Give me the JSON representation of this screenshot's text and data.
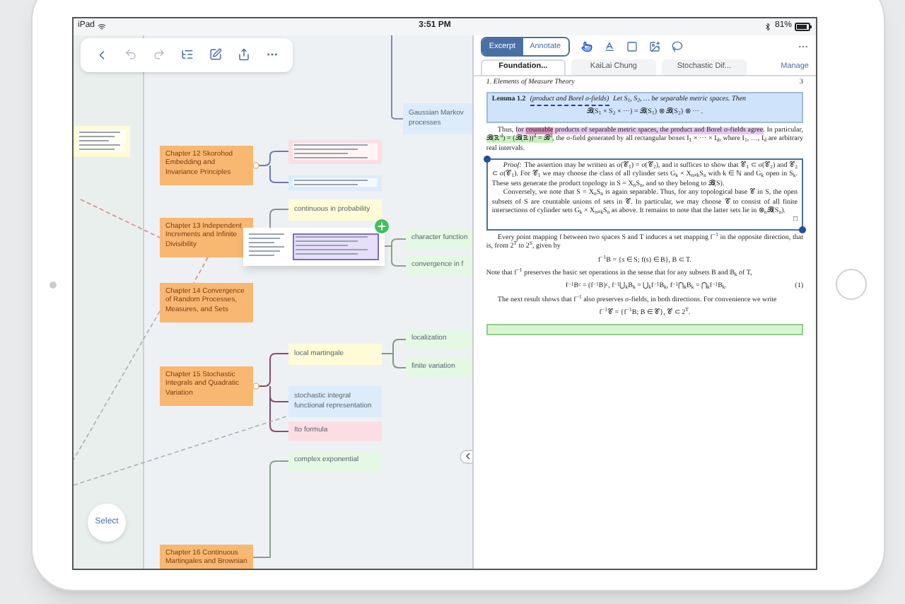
{
  "status_bar": {
    "device": "iPad",
    "time": "3:51 PM",
    "battery": "81%"
  },
  "mindmap": {
    "nodes": [
      {
        "kind": "topic",
        "text": "Gaussian Markov processes",
        "color": "#dcecfb"
      },
      {
        "kind": "snippet",
        "color": "#fffbd6"
      },
      {
        "kind": "chapter",
        "text": "Chapter 12 Skorohod Embedding and Invariance Principles",
        "color": "#f9b872"
      },
      {
        "kind": "snippet",
        "color": "#fddde4"
      },
      {
        "kind": "snippet",
        "color": "#dcecfb"
      },
      {
        "kind": "topic",
        "text": "continuous in probability",
        "color": "#fffbd6"
      },
      {
        "kind": "chapter",
        "text": "Chapter 13 Independent Increments and Infinite Divisibility",
        "color": "#f9b872"
      },
      {
        "kind": "topic",
        "text": "character function",
        "color": "#e4f8e4"
      },
      {
        "kind": "topic",
        "text": "convergence in f",
        "color": "#e4f8e4"
      },
      {
        "kind": "chapter",
        "text": "Chapter 14 Convergence of Random Processes, Measures, and Sets",
        "color": "#f9b872"
      },
      {
        "kind": "topic",
        "text": "local martingale",
        "color": "#fffbd6"
      },
      {
        "kind": "topic",
        "text": "localization",
        "color": "#e4f8e4"
      },
      {
        "kind": "topic",
        "text": "finite variation",
        "color": "#e4f8e4"
      },
      {
        "kind": "chapter",
        "text": "Chapter 15 Stochastic Integrals and Quadratic Variation",
        "color": "#f9b872"
      },
      {
        "kind": "topic",
        "text": "stochastic integral functional representation",
        "color": "#dcecfb"
      },
      {
        "kind": "topic",
        "text": "Ito formula",
        "color": "#fddde4"
      },
      {
        "kind": "topic",
        "text": "complex exponential",
        "color": "#e4f8e4"
      },
      {
        "kind": "chapter",
        "text": "Chapter 16 Continuous Martingales and Brownian",
        "color": "#f9b872"
      },
      {
        "kind": "excerpt",
        "color": "#ffffff"
      }
    ],
    "select_button": "Select"
  },
  "reader": {
    "modes": [
      {
        "label": "Excerpt",
        "selected": true
      },
      {
        "label": "Annotate",
        "selected": false
      }
    ],
    "tools": [
      {
        "kind": "pointer",
        "selected": true
      },
      {
        "kind": "text",
        "selected": false
      },
      {
        "kind": "rectangle",
        "selected": false
      },
      {
        "kind": "image",
        "selected": false
      },
      {
        "kind": "lasso",
        "selected": false
      }
    ],
    "tabs": [
      {
        "label": "Foundation...",
        "selected": true
      },
      {
        "label": "KaiLai Chung",
        "selected": false
      },
      {
        "label": "Stochastic Dif...",
        "selected": false
      }
    ],
    "manage": "Manage",
    "page": {
      "running_head": "1. Elements of Measure Theory",
      "page_number": "3",
      "lemma": {
        "label": "Lemma 1.2",
        "title": "(product and Borel σ-fields)",
        "text": "Let S$_{1}$, S$_{2}$, … be separable metric spaces. Then",
        "formula": "𝓑(S$_{1}$ × S$_{2}$ × ⋯) = 𝓑(S$_{1}$) ⊗ 𝓑(S$_{2}$) ⊗ ⋯ ."
      },
      "paragraph_1": [
        {
          "text": "Thus, "
        },
        {
          "text": "for ",
          "color": "#ecc8f0"
        },
        {
          "text": "countable",
          "color": "#d98fbd"
        },
        {
          "text": " products of separable metric spaces, the product and Borel σ-fields agree",
          "color": "#e6c8f2"
        },
        {
          "text": ". In particular, "
        },
        {
          "text": "𝓑(ℝ$^{d}$) = (𝓑(ℝ))$^{d}$ = 𝓑$^{d}$",
          "color": "#c9f0c0"
        },
        {
          "text": ", the σ-field generated by all rectangular boxes I$_{1}$ × ⋯ × I$_{d}$, where I$_{1}$, …, I$_{d}$ are arbitrary real intervals."
        }
      ],
      "proof": {
        "label": "Proof:",
        "paragraphs": [
          "The assertion may be written as σ(𝒞$_{1}$) = σ(𝒞$_{2}$), and it suffices to show that 𝒞$_{1}$ ⊂ σ(𝒞$_{2}$) and 𝒞$_{2}$ ⊂ σ(𝒞$_{1}$). For 𝒞$_{1}$ we may choose the class of all cylinder sets G$_{k}$ × X$_{n≠k}$S$_{n}$ with k ∈ ℕ and G$_{k}$ open in S$_{k}$. These sets generate the product topology in S = X$_{n}$S$_{n}$, and so they belong to 𝓑(S).",
          "Conversely, we note that S = X$_{n}$S$_{n}$ is again separable. Thus, for any topological base 𝒞 in S, the open subsets of S are countable unions of sets in 𝒞. In particular, we may choose 𝒞 to consist of all finite intersections of cylinder sets G$_{k}$ × X$_{n≠k}$S$_{n}$ as above. It remains to note that the latter sets lie in ⊗$_{n}$𝓑(S$_{n}$)."
        ],
        "qed": "□"
      },
      "paragraph_2": "Every point mapping f between two spaces S and T induces a set mapping f$^{−1}$ in the opposite direction, that is, from 2$^{T}$ to 2$^{S}$, given by",
      "formula_2": "f$^{−1}$B = {s ∈ S; f(s) ∈ B},    B ⊂ T.",
      "paragraph_3": "Note that f$^{−1}$ preserves the basic set operations in the sense that for any subsets B and B$_{k}$ of T,",
      "formula_3": "f$^{−1}$B$^{c}$ = (f$^{−1}$B)$^{c}$,   f$^{−1}$⋃$_{k}$B$_{k}$ = ⋃$_{k}$f$^{−1}$B$_{k}$,   f$^{−1}$⋂$_{k}$B$_{k}$ = ⋂$_{k}$f$^{−1}$B$_{k}$.",
      "formula_3_number": "(1)",
      "paragraph_4": "The next result shows that f$^{−1}$ also preserves σ-fields, in both directions. For convenience we write",
      "formula_4": "f$^{−1}$𝒞 = {f$^{−1}$B; B ∈ 𝒞},   𝒞 ⊂ 2$^{T}$."
    }
  }
}
